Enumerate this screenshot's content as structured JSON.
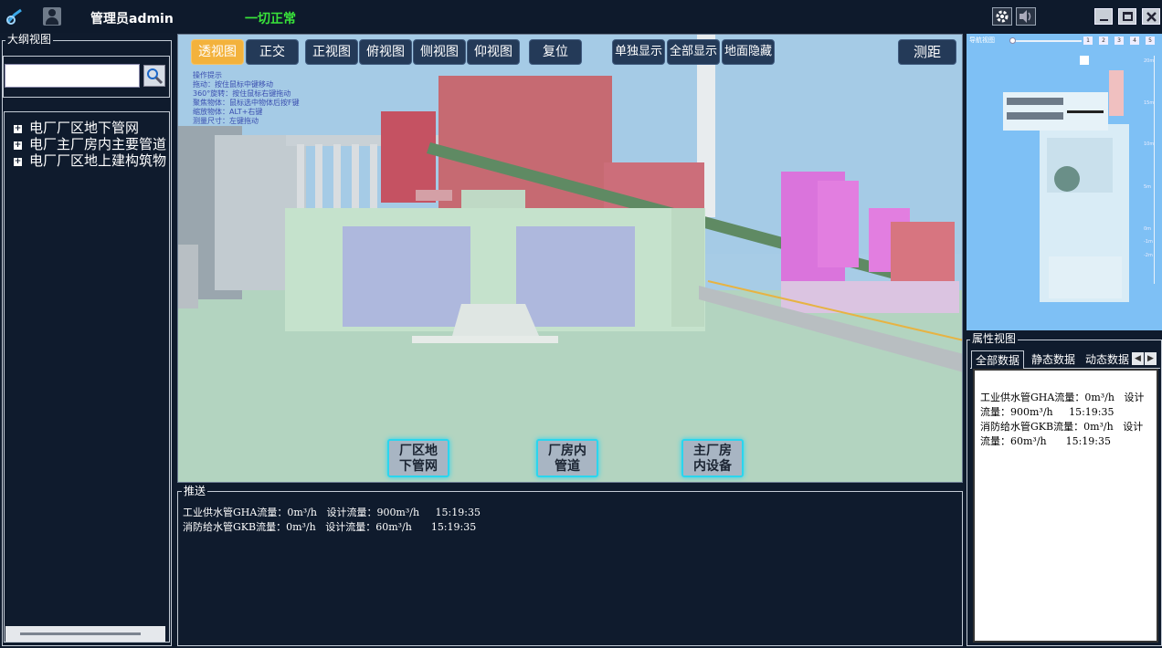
{
  "topbar": {
    "admin_label": "管理员admin",
    "status_text": "一切正常",
    "status_color": "#39e33a"
  },
  "left": {
    "panel_title": "大纲视图",
    "search_value": "",
    "tree": [
      {
        "label": "电厂厂区地下管网"
      },
      {
        "label": "电厂主厂房内主要管道"
      },
      {
        "label": "电厂厂区地上建构筑物"
      }
    ]
  },
  "view": {
    "buttons": [
      {
        "label": "透视图",
        "active": true
      },
      {
        "label": "正交"
      },
      {
        "label": "正视图"
      },
      {
        "label": "俯视图"
      },
      {
        "label": "侧视图"
      },
      {
        "label": "仰视图"
      },
      {
        "label": "复位"
      },
      {
        "label": "单独显示"
      },
      {
        "label": "全部显示"
      },
      {
        "label": "地面隐藏"
      },
      {
        "label": "测距"
      }
    ],
    "hints": [
      "操作提示",
      "拖动：按住鼠标中键移动",
      "360°旋转：按住鼠标右键拖动",
      "聚焦物体：鼠标选中物体后按F键",
      "缩放物体：ALT+右键",
      "测量尺寸：左键拖动"
    ],
    "bottom_buttons": [
      {
        "line1": "厂区地",
        "line2": "下管网"
      },
      {
        "line1": "厂房内",
        "line2": "管道"
      },
      {
        "line1": "主厂房",
        "line2": "内设备"
      }
    ]
  },
  "push": {
    "title": "推送",
    "lines": [
      "工业供水管GHA流量：0m³/h   设计流量：900m³/h     15:19:35",
      "消防给水管GKB流量：0m³/h   设计流量：60m³/h      15:19:35"
    ]
  },
  "minimap": {
    "title": "导航视图",
    "zoom_buttons": [
      "1",
      "2",
      "3",
      "4",
      "5"
    ],
    "scale_labels": [
      "20m",
      "15m",
      "10m",
      "5m",
      "0m",
      "-1m",
      "-2m"
    ]
  },
  "props": {
    "title": "属性视图",
    "tabs": [
      "全部数据",
      "静态数据",
      "动态数据"
    ],
    "lines": [
      "工业供水管GHA流量：0m³/h   设计",
      "流量：900m³/h     15:19:35",
      "消防给水管GKB流量：0m³/h   设计",
      "流量：60m³/h      15:19:35"
    ]
  }
}
